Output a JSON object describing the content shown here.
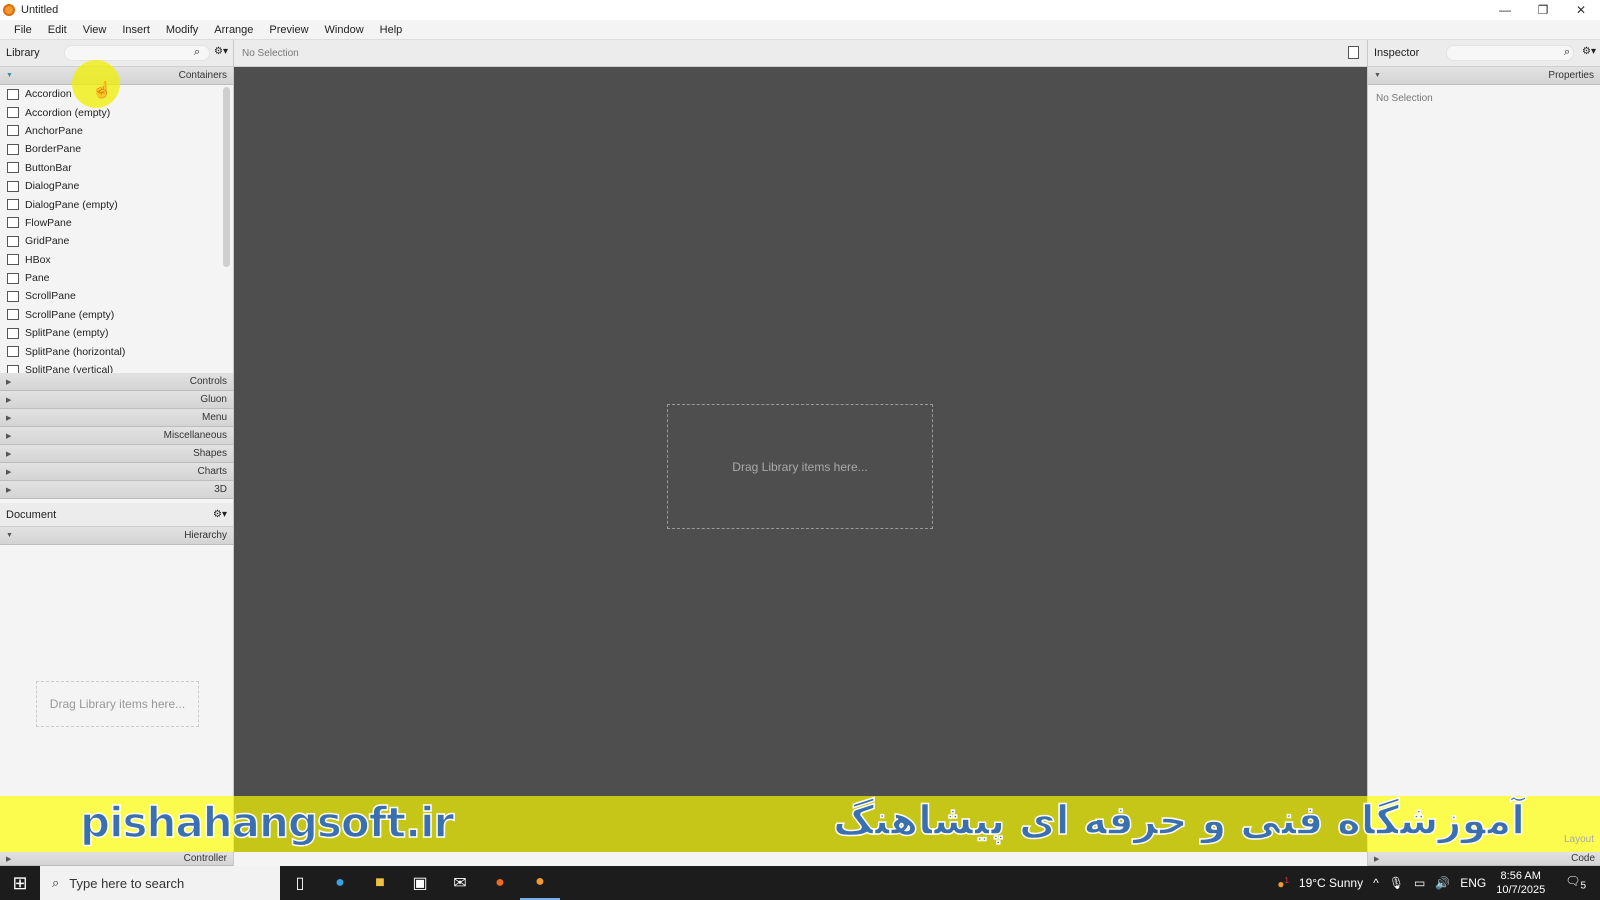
{
  "window": {
    "title": "Untitled",
    "min": "—",
    "max": "❐",
    "close": "✕"
  },
  "menu": [
    "File",
    "Edit",
    "View",
    "Insert",
    "Modify",
    "Arrange",
    "Preview",
    "Window",
    "Help"
  ],
  "library": {
    "title": "Library",
    "section": "Containers",
    "items": [
      "Accordion",
      "Accordion  (empty)",
      "AnchorPane",
      "BorderPane",
      "ButtonBar",
      "DialogPane",
      "DialogPane  (empty)",
      "FlowPane",
      "GridPane",
      "HBox",
      "Pane",
      "ScrollPane",
      "ScrollPane  (empty)",
      "SplitPane  (empty)",
      "SplitPane  (horizontal)",
      "SplitPane  (vertical)"
    ],
    "collapsed": [
      "Controls",
      "Gluon",
      "Menu",
      "Miscellaneous",
      "Shapes",
      "Charts",
      "3D"
    ]
  },
  "document": {
    "title": "Document",
    "section": "Hierarchy",
    "drop_hint": "Drag Library items here..."
  },
  "controller": "Controller",
  "canvas": {
    "selection": "No Selection",
    "drop_hint": "Drag Library items here..."
  },
  "inspector": {
    "title": "Inspector",
    "section": "Properties",
    "no_selection": "No Selection",
    "layout": "Layout",
    "code": "Code"
  },
  "banner": {
    "site": "pishahangsoft.ir",
    "persian": "آموزشگاه فنی و حرفه ای پیشاهنگ",
    "color": "#3a6fb0"
  },
  "taskbar": {
    "search_placeholder": "Type here to search",
    "weather": "19°C  Sunny",
    "lang": "ENG",
    "time": "8:56 AM",
    "date": "10/7/2025",
    "notifications": "5",
    "weather_badge": "1"
  }
}
